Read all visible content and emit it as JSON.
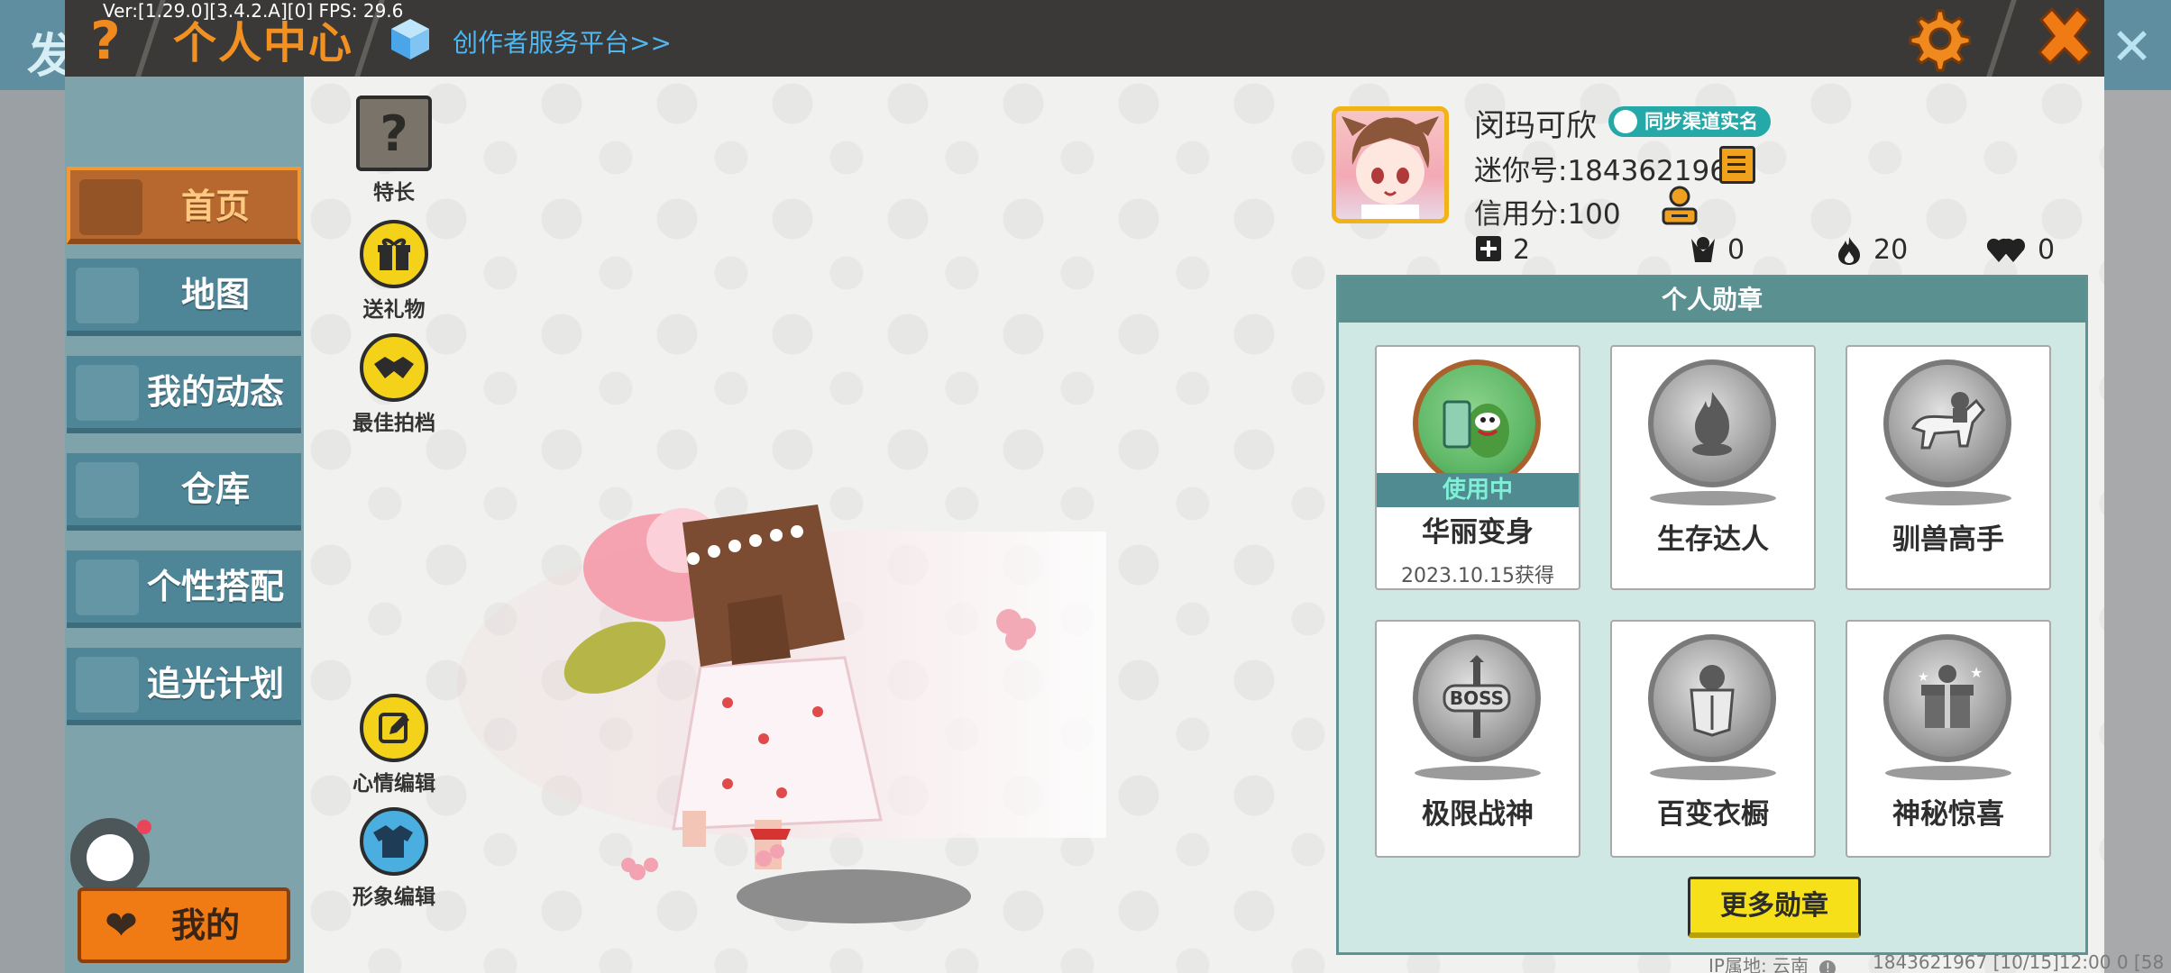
{
  "app": {
    "version_fps": "Ver:[1.29.0][3.4.2.A][0] FPS: 29.6",
    "title": "个人中心",
    "creator_link": "创作者服务平台>>",
    "background_char": "发"
  },
  "nav": {
    "items": [
      {
        "label": "首页",
        "active": true
      },
      {
        "label": "地图",
        "active": false
      },
      {
        "label": "我的动态",
        "active": false
      },
      {
        "label": "仓库",
        "active": false
      },
      {
        "label": "个性搭配",
        "active": false
      },
      {
        "label": "追光计划",
        "active": false
      }
    ],
    "mine_label": "我的"
  },
  "actions": {
    "talent": "特长",
    "gift": "送礼物",
    "best_shot": "最佳拍档",
    "mood_edit": "心情编辑",
    "avatar_edit": "形象编辑"
  },
  "profile": {
    "name": "闵玛可欣",
    "sync_badge": "同步渠道实名",
    "mini_id": "迷你号:1843621967",
    "credit": "信用分:100",
    "stats": {
      "add": "2",
      "fans": "0",
      "hot": "20",
      "likes": "0"
    }
  },
  "medals": {
    "header": "个人勋章",
    "in_use_label": "使用中",
    "items": [
      {
        "name": "华丽变身",
        "date": "2023.10.15获得",
        "active": true
      },
      {
        "name": "生存达人",
        "active": false
      },
      {
        "name": "驯兽高手",
        "active": false
      },
      {
        "name": "极限战神",
        "active": false
      },
      {
        "name": "百变衣橱",
        "active": false
      },
      {
        "name": "神秘惊喜",
        "active": false
      }
    ],
    "more_button": "更多勋章"
  },
  "footer": {
    "ip_location": "IP属地: 云南",
    "uid_time": "1843621967    [10/15]12:00 0  [58"
  },
  "colors": {
    "header_bg": "#3a3937",
    "title_orange": "#f29122",
    "nav_bg": "#4f8697",
    "nav_active": "#b7682f",
    "medal_header": "#5a9190",
    "more_button": "#f5e01a",
    "sync_badge": "#24a8a8"
  }
}
